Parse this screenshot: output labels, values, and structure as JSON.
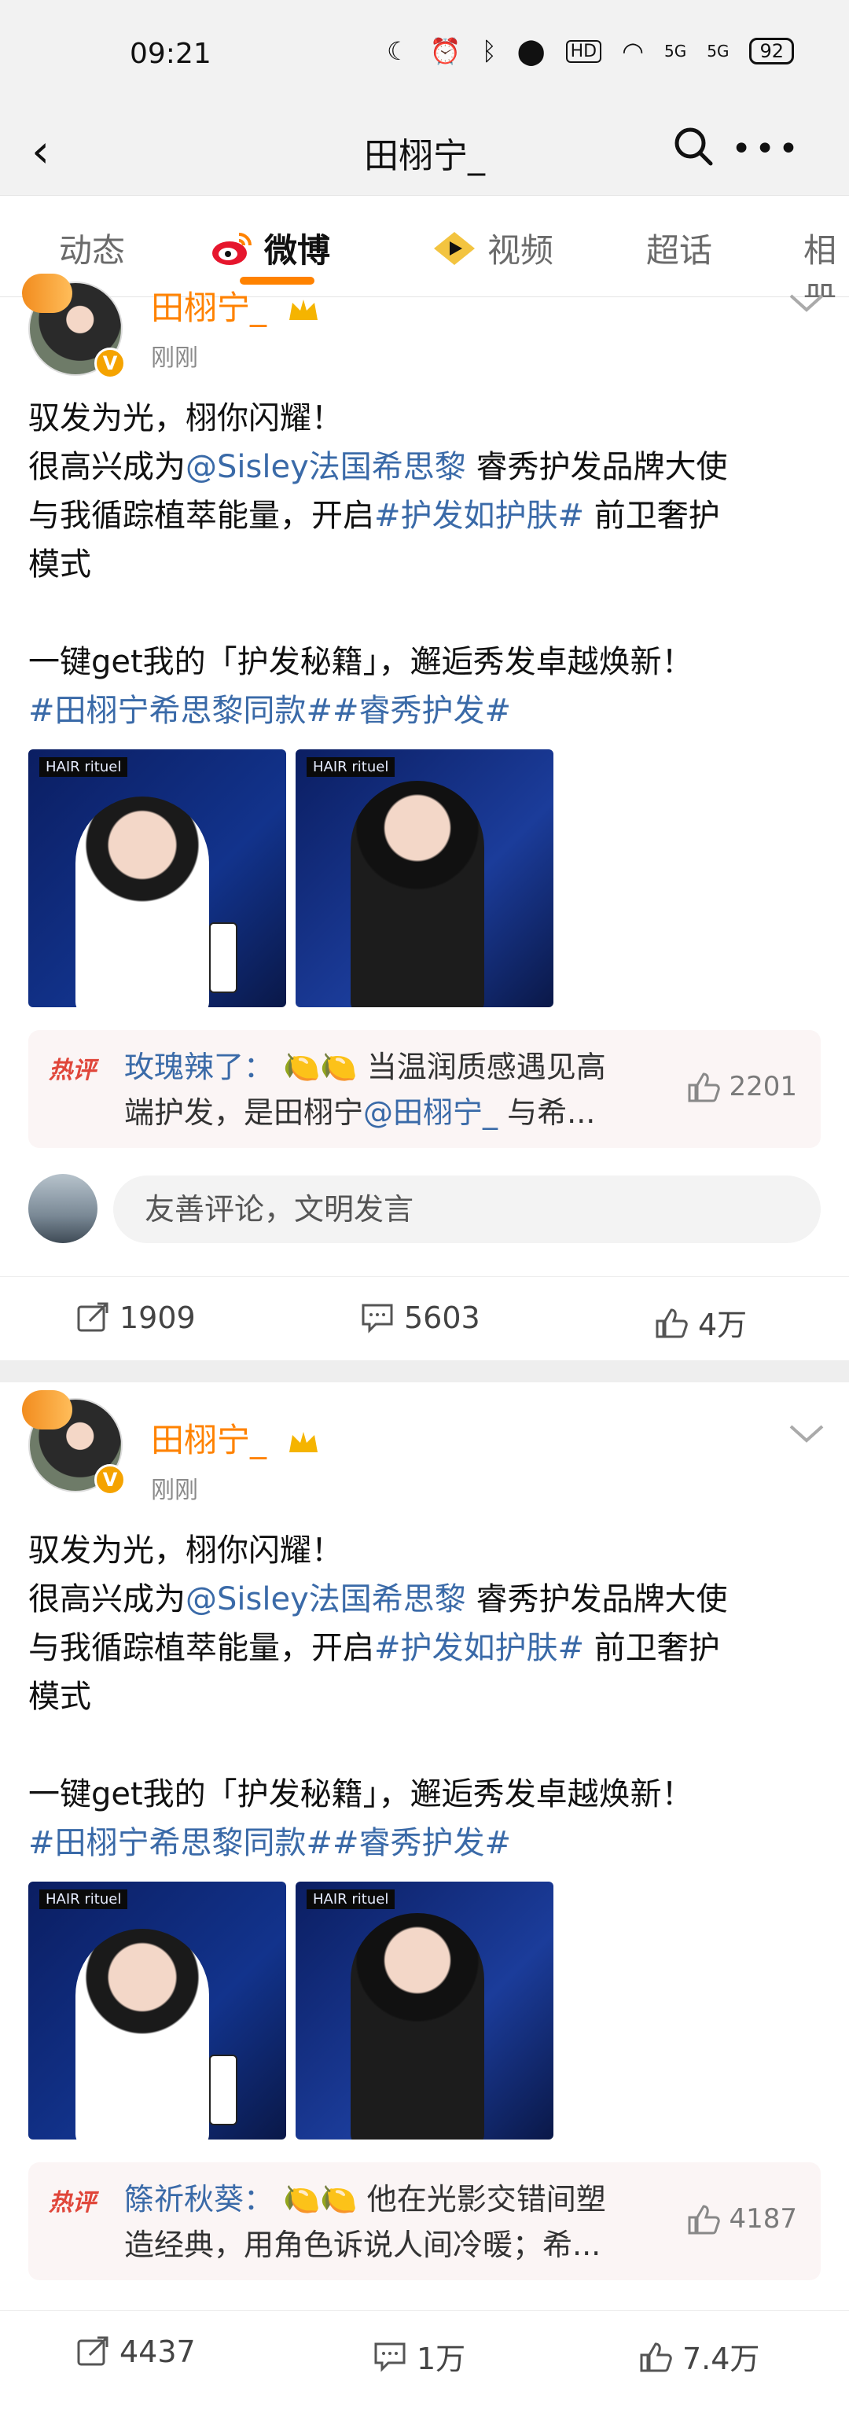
{
  "status": {
    "time": "09:21",
    "battery": "92",
    "signal_a": "5G",
    "signal_b": "5G",
    "hd": "HD"
  },
  "nav": {
    "title": "田栩宁_"
  },
  "tabs": [
    {
      "label": "动态"
    },
    {
      "label": "微博"
    },
    {
      "label": "视频"
    },
    {
      "label": "超话"
    },
    {
      "label": "相册"
    }
  ],
  "posts": [
    {
      "author": "田栩宁_",
      "time": "刚刚",
      "line1": "驭发为光，栩你闪耀！",
      "line2_pre": "很高兴成为",
      "mention": "@Sisley法国希思黎",
      "line2_post": " 睿秀护发品牌大使",
      "line3_pre": "与我循踪植萃能量，开启",
      "topic1": "#护发如护肤#",
      "line3_post": " 前卫奢护",
      "line4": "模式",
      "line5": "一键get我的「护发秘籍」，邂逅秀发卓越焕新！",
      "topics": "#田栩宁希思黎同款##睿秀护发#",
      "image_brand": "HAIR rituel",
      "hot_tag": "热评",
      "hot_user": "玫瑰辣了：",
      "hot_text": " 🍋🍋 当温润质感遇见高端护发，是田栩宁",
      "hot_mention": "@田栩宁_",
      "hot_tail": " 与希...",
      "hot_likes": "2201",
      "comment_placeholder": "友善评论，文明发言",
      "reposts": "1909",
      "comments": "5603",
      "likes": "4万"
    },
    {
      "author": "田栩宁_",
      "time": "刚刚",
      "line1": "驭发为光，栩你闪耀！",
      "line2_pre": "很高兴成为",
      "mention": "@Sisley法国希思黎",
      "line2_post": " 睿秀护发品牌大使",
      "line3_pre": "与我循踪植萃能量，开启",
      "topic1": "#护发如护肤#",
      "line3_post": " 前卫奢护",
      "line4": "模式",
      "line5": "一键get我的「护发秘籍」，邂逅秀发卓越焕新！",
      "topics": "#田栩宁希思黎同款##睿秀护发#",
      "image_brand": "HAIR rituel",
      "hot_tag": "热评",
      "hot_user": "篨祈秋葵：",
      "hot_text": " 🍋🍋 他在光影交错间塑造经典，用角色诉说人间冷暖；希...",
      "hot_likes": "4187",
      "reposts": "4437",
      "comments": "1万",
      "likes": "7.4万"
    }
  ],
  "colors": {
    "accent": "#ff8200",
    "link": "#3a6aa8",
    "hot": "#e0463a"
  }
}
